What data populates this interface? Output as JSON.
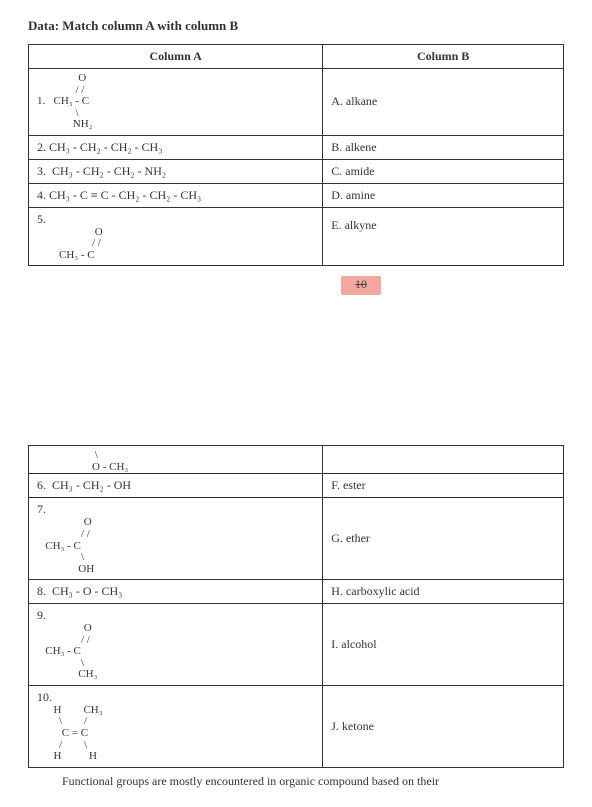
{
  "heading": "Data: Match column A with column B",
  "headers": {
    "colA": "Column A",
    "colB": "Column B"
  },
  "table1": {
    "rows": [
      {
        "num": "1.",
        "structure": "               O\n              / /\n  CH₃ - C\n              \\\n             NH₂",
        "optLabel": "A.",
        "opt": "alkane"
      },
      {
        "num": "2.",
        "structure": "CH₃ - CH₂ - CH₂ - CH₃",
        "optLabel": "B.",
        "opt": "alkene"
      },
      {
        "num": "3.",
        "structure": "CH₃ - CH₂ - CH₂ - NH₂",
        "optLabel": "C.",
        "opt": "amide"
      },
      {
        "num": "4.",
        "structure": "CH₃ - C ≡ C - CH₂ - CH₂ - CH₃",
        "optLabel": "D.",
        "opt": "amine"
      },
      {
        "num": "5.",
        "structure": "                     O\n                    / /\n        CH₃ - C",
        "optLabel": "E.",
        "opt": "alkyne"
      }
    ]
  },
  "pageNumber": "10",
  "table2": {
    "rows": [
      {
        "topStruct": "                     \\\n                    O - CH₃",
        "num": "6.",
        "structure": "CH₃ - CH₂ - OH",
        "optLabel": "F.",
        "opt": "ester"
      },
      {
        "num": "7.",
        "structure": "                 O\n                / /\n   CH₃ - C\n                \\\n               OH",
        "optLabel": "G.",
        "opt": "ether"
      },
      {
        "num": "8.",
        "structure": "CH₃ - O - CH₃",
        "optLabel": "H.",
        "opt": "carboxylic acid"
      },
      {
        "num": "9.",
        "structure": "                 O\n                / /\n   CH₃ - C\n                \\\n               CH₃",
        "optLabel": "I.",
        "opt": "alcohol"
      },
      {
        "num": "10.",
        "structure": "      H        CH₃\n        \\        /\n         C = C\n        /        \\\n      H          H",
        "optLabel": "J.",
        "opt": "ketone"
      }
    ]
  },
  "footer": "Functional groups are mostly encountered in organic compound based on their"
}
